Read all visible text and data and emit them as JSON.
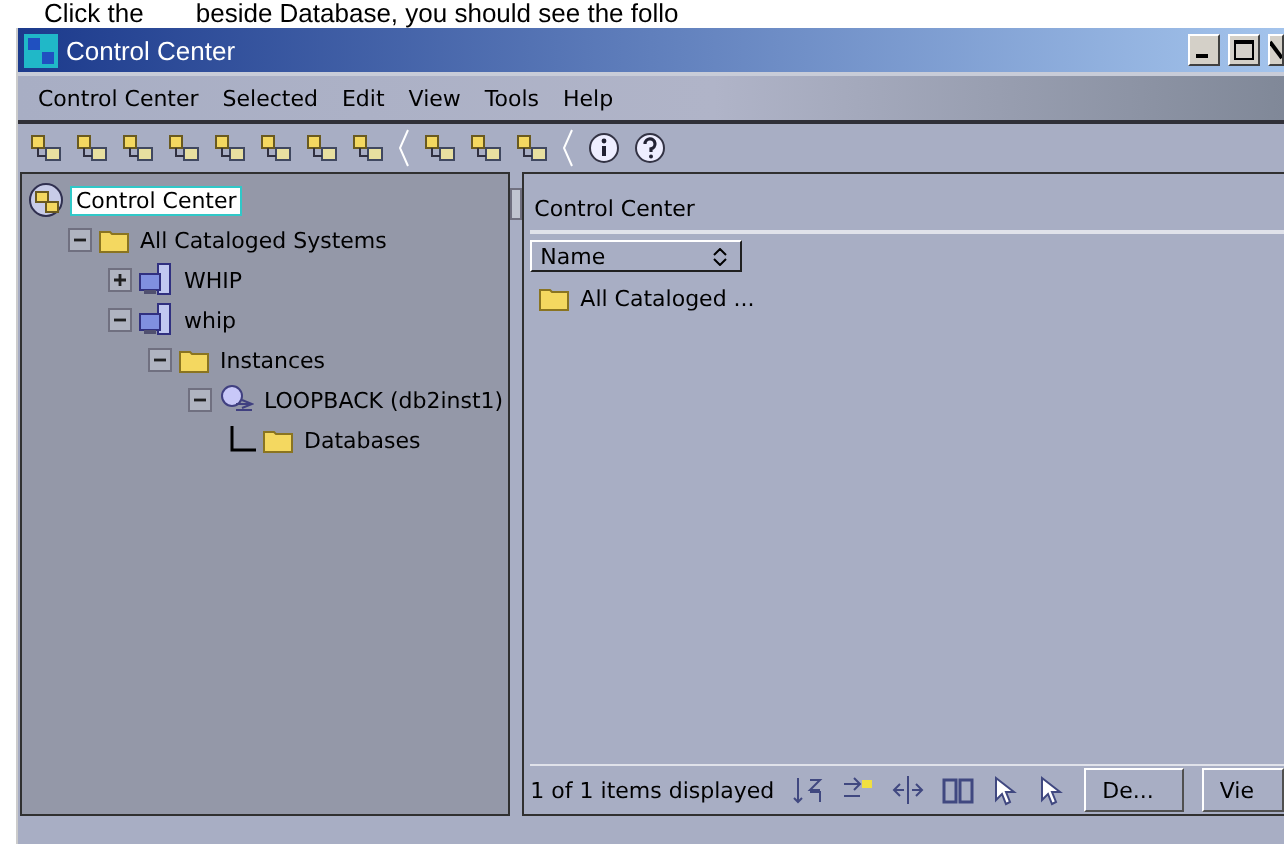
{
  "caption": {
    "before": "Click the",
    "after": "beside Database, you should see the follo"
  },
  "window": {
    "title": "Control Center"
  },
  "menu": [
    "Control Center",
    "Selected",
    "Edit",
    "View",
    "Tools",
    "Help"
  ],
  "toolbar": [
    {
      "kind": "tool"
    },
    {
      "kind": "tool"
    },
    {
      "kind": "tool"
    },
    {
      "kind": "tool"
    },
    {
      "kind": "tool"
    },
    {
      "kind": "tool"
    },
    {
      "kind": "tool"
    },
    {
      "kind": "tool"
    },
    {
      "kind": "sep"
    },
    {
      "kind": "tool"
    },
    {
      "kind": "tool"
    },
    {
      "kind": "tool"
    },
    {
      "kind": "sep"
    },
    {
      "kind": "info"
    },
    {
      "kind": "help"
    }
  ],
  "tree": [
    {
      "label": "Control Center",
      "kind": "root",
      "selected": true,
      "children": [
        {
          "label": "All Cataloged Systems",
          "kind": "folder",
          "selected": false,
          "expanded": true,
          "children": [
            {
              "label": "WHIP",
              "kind": "system",
              "selected": false,
              "expanded": false
            },
            {
              "label": "whip",
              "kind": "system",
              "selected": false,
              "expanded": true,
              "children": [
                {
                  "label": "Instances",
                  "kind": "folder",
                  "selected": false,
                  "expanded": true,
                  "children": [
                    {
                      "label": "LOOPBACK (db2inst1)",
                      "kind": "instance",
                      "selected": false,
                      "expanded": true,
                      "children": [
                        {
                          "label": "Databases",
                          "kind": "folder",
                          "selected": false
                        }
                      ]
                    }
                  ]
                }
              ]
            }
          ]
        }
      ]
    }
  ],
  "contents": {
    "title": "Control Center",
    "columns": [
      "Name"
    ],
    "rows": [
      {
        "name": "All Cataloged ..."
      }
    ],
    "status": "1 of 1 items displayed",
    "details_button": "De...",
    "view_button": "Vie"
  }
}
